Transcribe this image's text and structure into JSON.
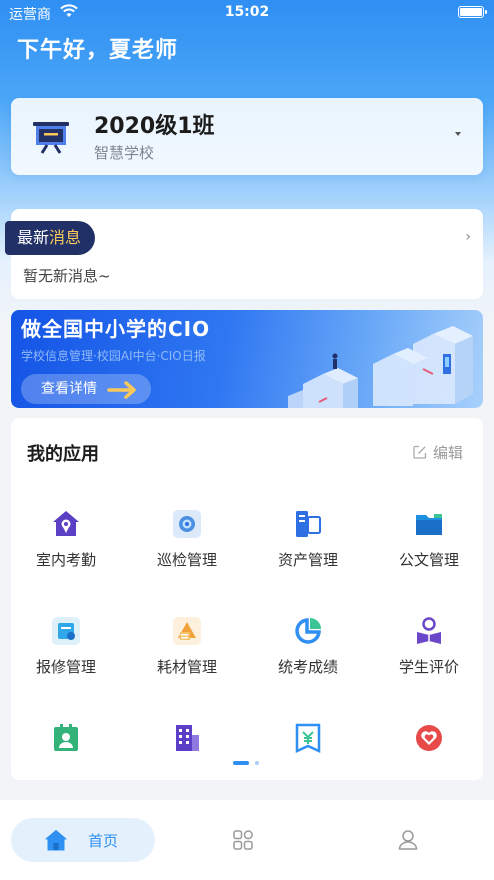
{
  "status_bar": {
    "carrier": "运营商",
    "time": "15:02"
  },
  "greeting": "下午好，夏老师",
  "class_card": {
    "class_name": "2020级1班",
    "school": "智慧学校"
  },
  "news": {
    "tag_prefix": "最新",
    "tag_highlight": "消息",
    "empty_text": "暂无新消息~"
  },
  "banner": {
    "title": "做全国中小学的CIO",
    "subtitle": "学校信息管理·校园AI中台·CIO日报",
    "button_label": "查看详情"
  },
  "apps": {
    "title": "我的应用",
    "edit_label": "编辑",
    "items": [
      {
        "label": "室内考勤",
        "icon": "home-location-icon",
        "color": "#5b3fc4"
      },
      {
        "label": "巡检管理",
        "icon": "inspection-icon",
        "color": "#4a90e2"
      },
      {
        "label": "资产管理",
        "icon": "assets-icon",
        "color": "#2f6fe4"
      },
      {
        "label": "公文管理",
        "icon": "folder-icon",
        "color": "#1f8fe0"
      },
      {
        "label": "报修管理",
        "icon": "repair-icon",
        "color": "#2fa7e8"
      },
      {
        "label": "耗材管理",
        "icon": "materials-icon",
        "color": "#f0a23a"
      },
      {
        "label": "统考成绩",
        "icon": "pie-chart-icon",
        "color": "#2f8ff3"
      },
      {
        "label": "学生评价",
        "icon": "student-icon",
        "color": "#6a47c8"
      },
      {
        "label": "",
        "icon": "contact-card-icon",
        "color": "#33b37a"
      },
      {
        "label": "",
        "icon": "building-icon",
        "color": "#5c3fc6"
      },
      {
        "label": "",
        "icon": "finance-book-icon",
        "color": "#2f8ff3"
      },
      {
        "label": "",
        "icon": "heart-shield-icon",
        "color": "#e84a4a"
      }
    ]
  },
  "tabbar": {
    "home_label": "首页"
  }
}
